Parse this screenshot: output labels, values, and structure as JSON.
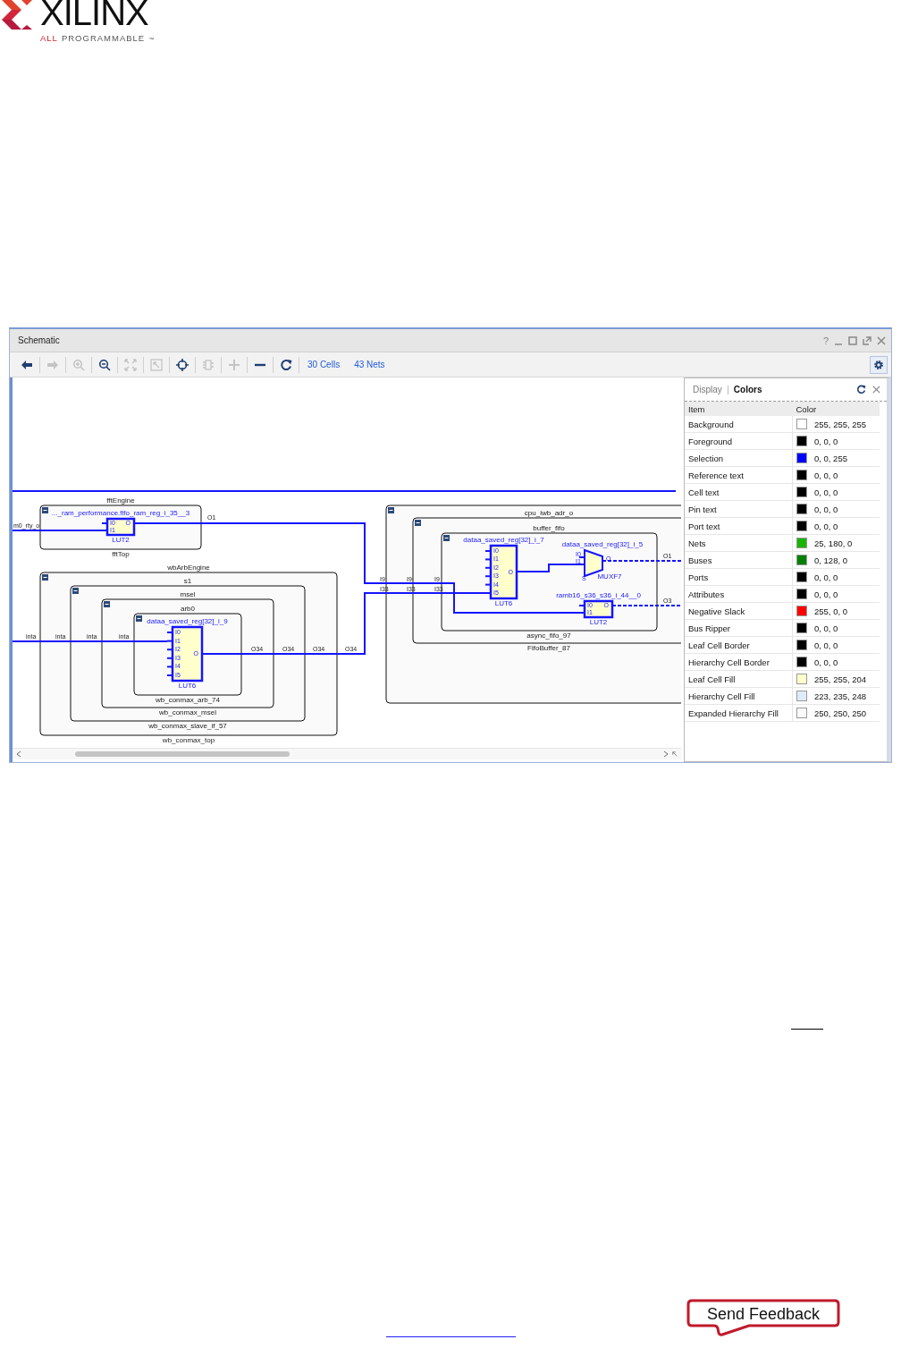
{
  "logo": {
    "wordmark": "XILINX",
    "tagline_highlight": "ALL",
    "tagline": "PROGRAMMABLE",
    "trademark": "™"
  },
  "window": {
    "title": "Schematic",
    "help": "?"
  },
  "toolbar": {
    "tools": [
      {
        "kind": "back",
        "disabled": false
      },
      {
        "kind": "forward",
        "disabled": true
      },
      {
        "kind": "zoom_in",
        "disabled": true
      },
      {
        "kind": "zoom_out",
        "disabled": false
      },
      {
        "kind": "fit",
        "disabled": true
      },
      {
        "kind": "zoom_selection",
        "disabled": true
      },
      {
        "kind": "crosshair",
        "disabled": false
      },
      {
        "kind": "chip",
        "disabled": true
      },
      {
        "kind": "plus",
        "disabled": true
      },
      {
        "kind": "minus",
        "disabled": false
      },
      {
        "kind": "refresh",
        "disabled": false
      }
    ],
    "links": [
      "30 Cells",
      "43 Nets"
    ]
  },
  "schematic": {
    "port": "m0_rty_o",
    "hierarchy": [
      {
        "top_label": "fftEngine",
        "expanded": true,
        "bottom_label": "fftTop"
      },
      {
        "top_label": "wbArbEngine",
        "expanded": true,
        "children": [
          {
            "top_label": "s1",
            "expanded": true,
            "children": [
              {
                "top_label": "msel",
                "expanded": true,
                "children": [
                  {
                    "top_label": "arb0",
                    "expanded": true,
                    "bottom_label": "wb_conmax_arb_74"
                  }
                ],
                "bottom_label": "wb_conmax_msel"
              }
            ],
            "bottom_label": "wb_conmax_slave_if_57"
          }
        ],
        "bottom_label": "wb_conmax_top"
      },
      {
        "expanded": true,
        "children": [
          {
            "top_label": "cpu_iwb_adr_o",
            "expanded": true,
            "children": [
              {
                "top_label": "buffer_fifo",
                "expanded": true,
                "bottom_label": "async_fifo_97"
              }
            ],
            "bottom_label": "FifoBuffer_87"
          }
        ]
      }
    ],
    "cells": [
      {
        "kind": "lut",
        "name": "..._ram_performance.fifo_ram_reg_i_35__3",
        "type": "LUT2",
        "inputs": [
          "I0",
          "I1"
        ],
        "output": "O"
      },
      {
        "kind": "lut",
        "name": "dataa_saved_reg[32]_i_9",
        "type": "LUT6",
        "inputs": [
          "I0",
          "I1",
          "I2",
          "I3",
          "I4",
          "I5"
        ],
        "output": "O"
      },
      {
        "kind": "lut",
        "name": "dataa_saved_reg[32]_i_7",
        "type": "LUT6",
        "inputs": [
          "I0",
          "I1",
          "I2",
          "I3",
          "I4",
          "I5"
        ],
        "output": "O"
      },
      {
        "kind": "mux",
        "name": "dataa_saved_reg[32]_i_5",
        "type": "MUXF7",
        "inputs": [
          "I0",
          "I1"
        ],
        "select": "S",
        "output": "O"
      },
      {
        "kind": "lut",
        "name": "ramb16_s36_s36_i_44__0",
        "type": "LUT2",
        "inputs": [
          "I0",
          "I1"
        ],
        "output": "O"
      }
    ],
    "net_labels": [
      "O1",
      "inta",
      "inta",
      "inta",
      "inta",
      "O34",
      "O34",
      "O34",
      "O34",
      "I9",
      "I9",
      "I9",
      "I33",
      "I33",
      "I33",
      "O1",
      "O3"
    ]
  },
  "colors_panel": {
    "tabs": [
      {
        "label": "Display",
        "selected": false
      },
      {
        "label": "Colors",
        "selected": true
      }
    ],
    "columns": [
      "Item",
      "Color"
    ],
    "rows": [
      {
        "item": "Background",
        "value": "255, 255, 255",
        "color": "#ffffff"
      },
      {
        "item": "Foreground",
        "value": "0, 0, 0",
        "color": "#000000"
      },
      {
        "item": "Selection",
        "value": "0, 0, 255",
        "color": "#0000ff"
      },
      {
        "item": "Reference text",
        "value": "0, 0, 0",
        "color": "#000000"
      },
      {
        "item": "Cell text",
        "value": "0, 0, 0",
        "color": "#000000"
      },
      {
        "item": "Pin text",
        "value": "0, 0, 0",
        "color": "#000000"
      },
      {
        "item": "Port text",
        "value": "0, 0, 0",
        "color": "#000000"
      },
      {
        "item": "Nets",
        "value": "25, 180, 0",
        "color": "#19b400"
      },
      {
        "item": "Buses",
        "value": "0, 128, 0",
        "color": "#008000"
      },
      {
        "item": "Ports",
        "value": "0, 0, 0",
        "color": "#000000"
      },
      {
        "item": "Attributes",
        "value": "0, 0, 0",
        "color": "#000000"
      },
      {
        "item": "Negative Slack",
        "value": "255, 0, 0",
        "color": "#ff0000"
      },
      {
        "item": "Bus Ripper",
        "value": "0, 0, 0",
        "color": "#000000"
      },
      {
        "item": "Leaf Cell Border",
        "value": "0, 0, 0",
        "color": "#000000"
      },
      {
        "item": "Hierarchy Cell Border",
        "value": "0, 0, 0",
        "color": "#000000"
      },
      {
        "item": "Leaf Cell Fill",
        "value": "255, 255, 204",
        "color": "#ffffcc"
      },
      {
        "item": "Hierarchy Cell Fill",
        "value": "223, 235, 248",
        "color": "#dfebf8"
      },
      {
        "item": "Expanded Hierarchy Fill",
        "value": "250, 250, 250",
        "color": "#fafafa"
      }
    ]
  },
  "feedback_button": "Send Feedback"
}
